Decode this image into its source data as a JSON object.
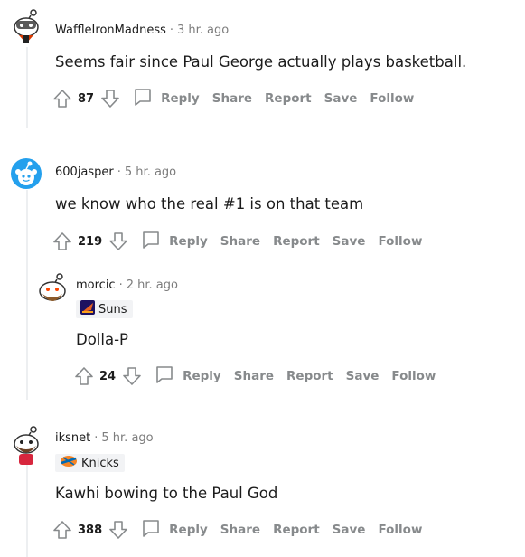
{
  "comments": [
    {
      "username": "WaffleIronMadness",
      "time": "3 hr. ago",
      "body": "Seems fair since Paul George actually plays basketball.",
      "score": "87"
    },
    {
      "username": "600jasper",
      "time": "5 hr. ago",
      "body": "we know who the real #1 is on that team",
      "score": "219"
    },
    {
      "username": "morcic",
      "time": "2 hr. ago",
      "flair": "Suns",
      "body": "Dolla-P",
      "score": "24"
    },
    {
      "username": "iksnet",
      "time": "5 hr. ago",
      "flair": "Knicks",
      "body": "Kawhi bowing to the Paul God",
      "score": "388"
    }
  ],
  "separator": "·",
  "actions": {
    "reply": "Reply",
    "share": "Share",
    "report": "Report",
    "save": "Save",
    "follow": "Follow"
  },
  "colors": {
    "action_gray": "#878a8c",
    "thread_line": "#edeff1",
    "flair_bg": "#f2f3f5",
    "snoo_blue": "#24a0ed"
  }
}
